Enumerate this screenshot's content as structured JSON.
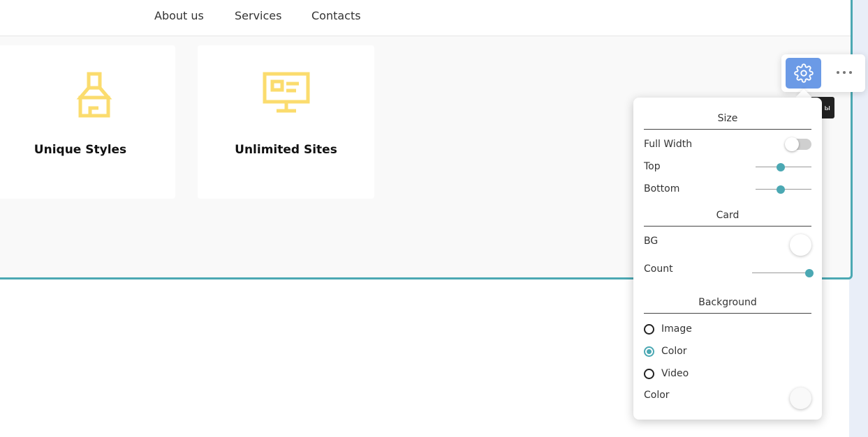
{
  "nav": {
    "links": [
      "About us",
      "Services",
      "Contacts"
    ]
  },
  "cards": [
    {
      "title": "Unique Styles",
      "icon": "paint-brush-icon"
    },
    {
      "title": "Unlimited Sites",
      "icon": "monitor-icon"
    }
  ],
  "toolbar": {
    "settings_icon": "gear-icon",
    "more_icon": "more-dots-icon",
    "hidden_tag": "ы"
  },
  "panel": {
    "size": {
      "title": "Size",
      "full_width_label": "Full Width",
      "full_width_on": false,
      "top_label": "Top",
      "top_value": 0.45,
      "bottom_label": "Bottom",
      "bottom_value": 0.45
    },
    "card": {
      "title": "Card",
      "bg_label": "BG",
      "bg_color": "#ffffff",
      "count_label": "Count",
      "count_value": 1.0
    },
    "background": {
      "title": "Background",
      "options": [
        "Image",
        "Color",
        "Video"
      ],
      "selected": "Color",
      "color_label": "Color",
      "color_value": "#f9f9f9"
    }
  },
  "colors": {
    "accent": "#4ba8b3",
    "icon_yellow": "#fbdc6e",
    "button_blue": "#6b9ae6"
  }
}
